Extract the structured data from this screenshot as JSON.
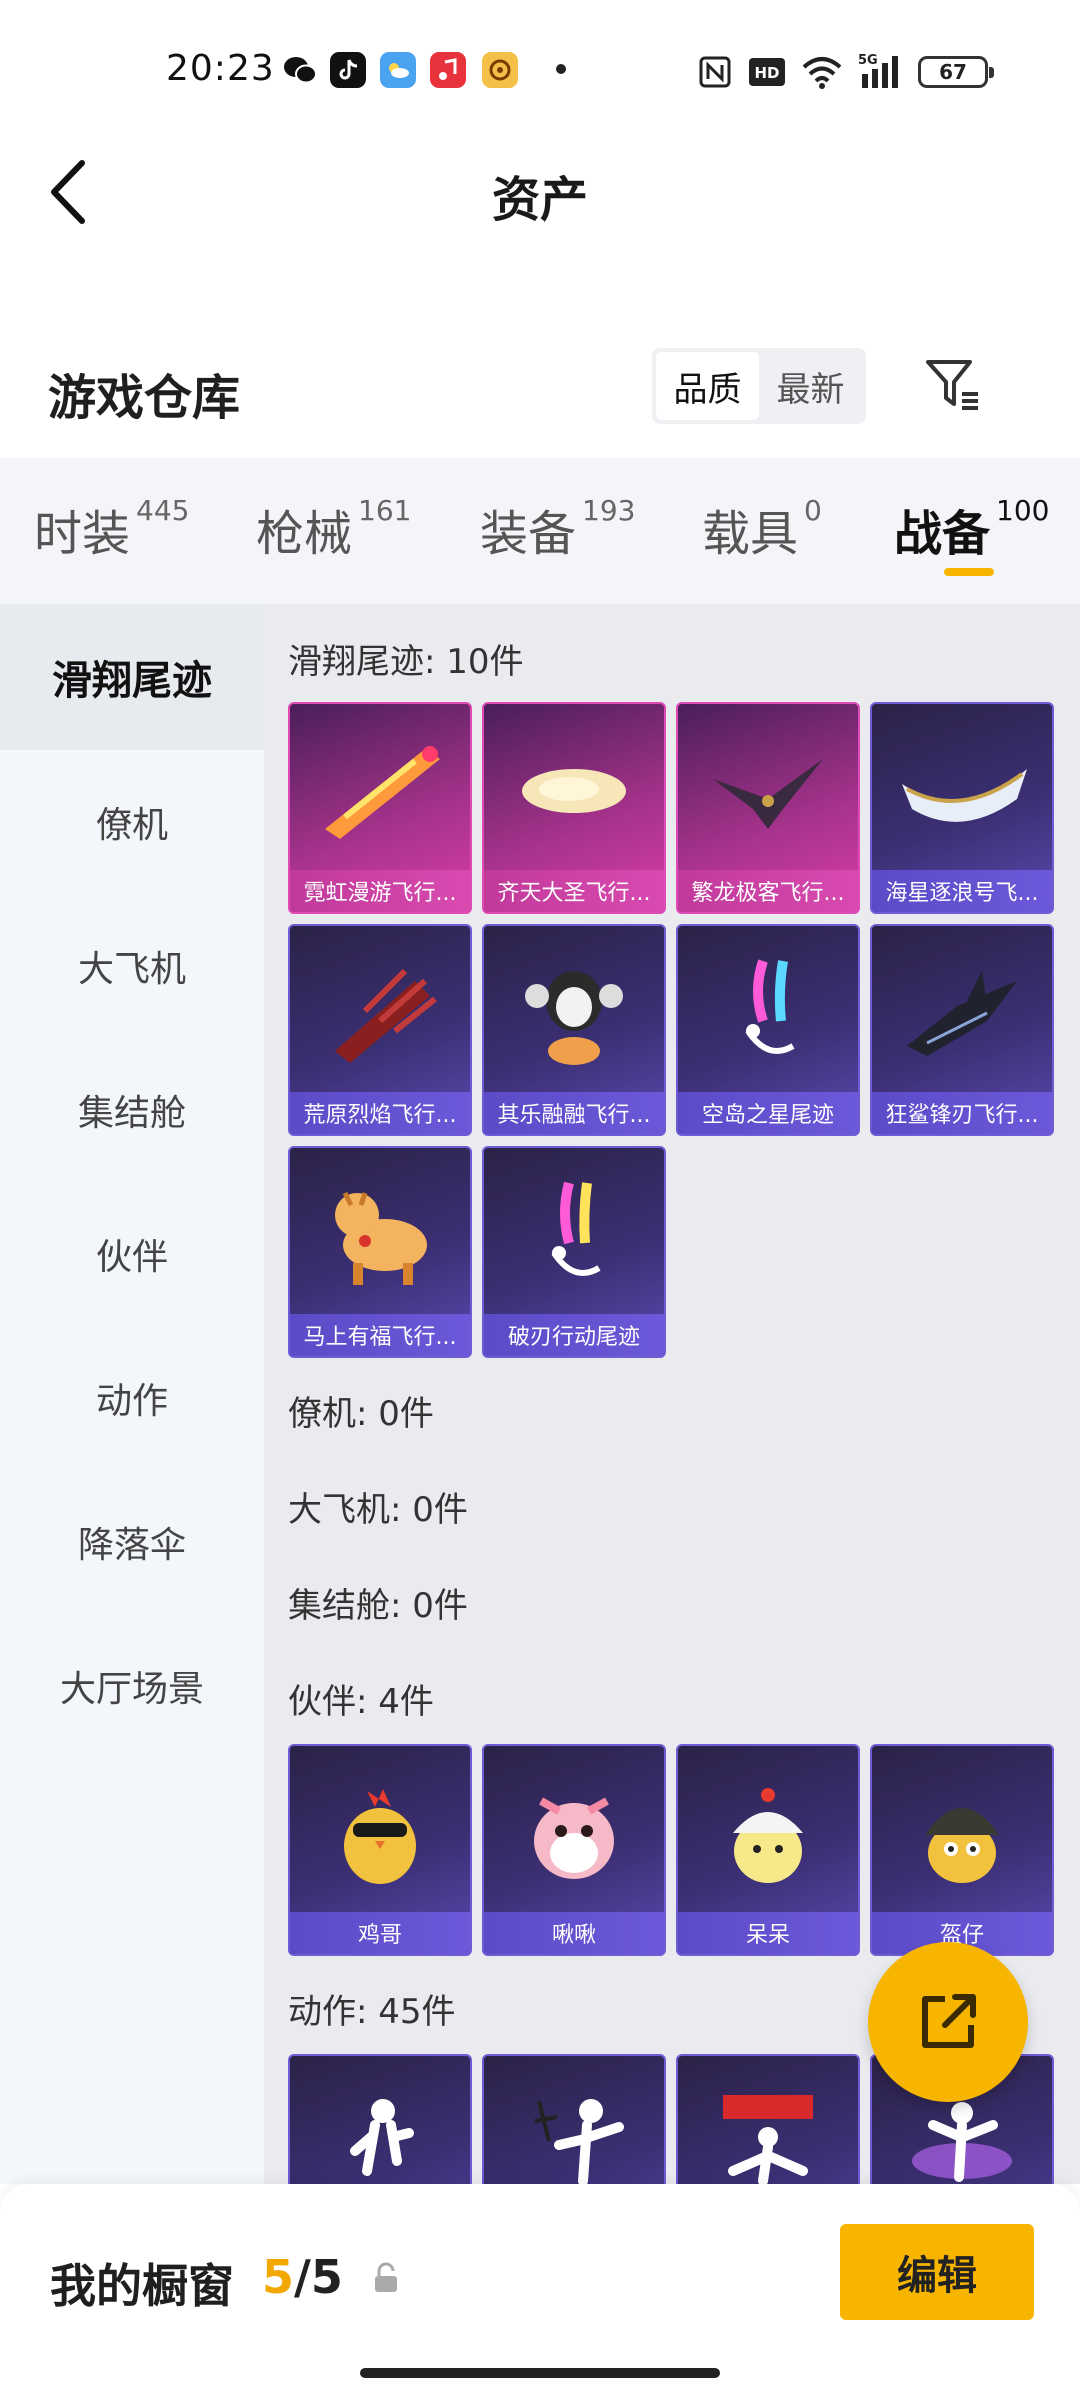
{
  "status_bar": {
    "time": "20:23",
    "battery": "67",
    "net_label": "5G",
    "hd_label": "HD",
    "icons": [
      "wechat-icon",
      "tiktok-icon",
      "weather-icon",
      "music-icon",
      "browser-icon",
      "nfc-icon",
      "hd-icon",
      "wifi-icon",
      "signal-icon",
      "battery-icon"
    ]
  },
  "header": {
    "title": "资产"
  },
  "section": {
    "title": "游戏仓库",
    "sort_options": [
      "品质",
      "最新"
    ],
    "sort_selected": "品质"
  },
  "tabs": [
    {
      "label": "时装",
      "count": "445"
    },
    {
      "label": "枪械",
      "count": "161"
    },
    {
      "label": "装备",
      "count": "193"
    },
    {
      "label": "载具",
      "count": "0"
    },
    {
      "label": "战备",
      "count": "100"
    }
  ],
  "active_tab": "战备",
  "sidebar": {
    "items": [
      "滑翔尾迹",
      "僚机",
      "大飞机",
      "集结舱",
      "伙伴",
      "动作",
      "降落伞",
      "大厅场景"
    ],
    "active": "滑翔尾迹"
  },
  "groups": [
    {
      "title": "滑翔尾迹: 10件",
      "items": [
        {
          "name": "霓虹漫游飞行...",
          "rarity": "pink"
        },
        {
          "name": "齐天大圣飞行...",
          "rarity": "pink"
        },
        {
          "name": "繁龙极客飞行...",
          "rarity": "pink"
        },
        {
          "name": "海星逐浪号飞...",
          "rarity": "purple"
        },
        {
          "name": "荒原烈焰飞行...",
          "rarity": "purple"
        },
        {
          "name": "其乐融融飞行...",
          "rarity": "purple"
        },
        {
          "name": "空岛之星尾迹",
          "rarity": "purple"
        },
        {
          "name": "狂鲨锋刃飞行...",
          "rarity": "purple"
        },
        {
          "name": "马上有福飞行...",
          "rarity": "purple"
        },
        {
          "name": "破刃行动尾迹",
          "rarity": "purple"
        }
      ]
    },
    {
      "title": "僚机: 0件",
      "items": []
    },
    {
      "title": "大飞机: 0件",
      "items": []
    },
    {
      "title": "集结舱: 0件",
      "items": []
    },
    {
      "title": "伙伴: 4件",
      "items": [
        {
          "name": "鸡哥",
          "rarity": "purple"
        },
        {
          "name": "啾啾",
          "rarity": "purple"
        },
        {
          "name": "呆呆",
          "rarity": "purple"
        },
        {
          "name": "盔仔",
          "rarity": "purple"
        }
      ]
    },
    {
      "title": "动作: 45件",
      "items": [
        {
          "name": "",
          "rarity": "purple"
        },
        {
          "name": "",
          "rarity": "purple"
        },
        {
          "name": "",
          "rarity": "purple"
        },
        {
          "name": "",
          "rarity": "purple"
        }
      ]
    }
  ],
  "bottom_bar": {
    "label": "我的橱窗",
    "current": "5",
    "separator": "/",
    "total": "5",
    "edit_label": "编辑"
  },
  "colors": {
    "accent": "#f7b500",
    "rarity_pink": "#d93ea5",
    "rarity_purple": "#5b48b0"
  }
}
